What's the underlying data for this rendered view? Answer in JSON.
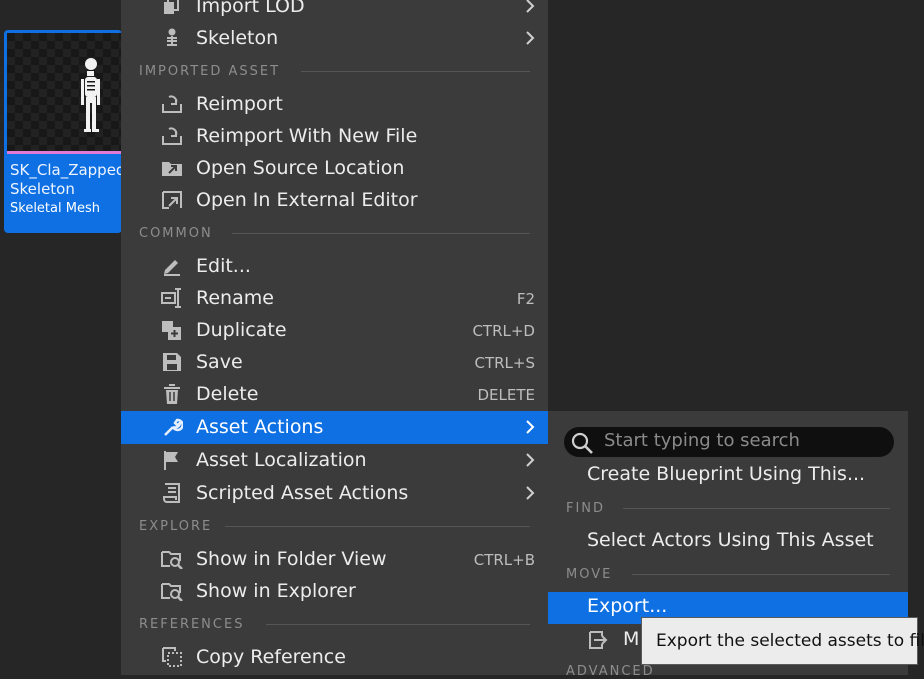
{
  "asset": {
    "name": "SK_Cla_Zapped\nSkeleton",
    "type": "Skeletal Mesh"
  },
  "menu": {
    "items_top": [
      {
        "label": "Import LOD",
        "icon": "import-lod-icon"
      },
      {
        "label": "Skeleton",
        "icon": "skeleton-icon"
      }
    ],
    "imported_asset": {
      "header": "IMPORTED ASSET",
      "items": [
        {
          "label": "Reimport",
          "icon": "reimport-icon"
        },
        {
          "label": "Reimport With New File",
          "icon": "reimport-new-file-icon"
        },
        {
          "label": "Open Source Location",
          "icon": "open-source-location-icon"
        },
        {
          "label": "Open In External Editor",
          "icon": "external-editor-icon"
        }
      ]
    },
    "common": {
      "header": "COMMON",
      "items": [
        {
          "label": "Edit...",
          "icon": "pencil-icon",
          "shortcut": ""
        },
        {
          "label": "Rename",
          "icon": "rename-icon",
          "shortcut": "F2"
        },
        {
          "label": "Duplicate",
          "icon": "duplicate-icon",
          "shortcut": "CTRL+D"
        },
        {
          "label": "Save",
          "icon": "save-icon",
          "shortcut": "CTRL+S"
        },
        {
          "label": "Delete",
          "icon": "trash-icon",
          "shortcut": "DELETE"
        },
        {
          "label": "Asset Actions",
          "icon": "wrench-icon",
          "shortcut": ""
        },
        {
          "label": "Asset Localization",
          "icon": "flag-icon",
          "shortcut": ""
        },
        {
          "label": "Scripted Asset Actions",
          "icon": "script-icon",
          "shortcut": ""
        }
      ]
    },
    "explore": {
      "header": "EXPLORE",
      "items": [
        {
          "label": "Show in Folder View",
          "icon": "folder-search-icon",
          "shortcut": "CTRL+B"
        },
        {
          "label": "Show in Explorer",
          "icon": "folder-search-icon",
          "shortcut": ""
        }
      ]
    },
    "references": {
      "header": "REFERENCES",
      "items": [
        {
          "label": "Copy Reference",
          "icon": "copy-reference-icon"
        }
      ]
    }
  },
  "submenu": {
    "search_placeholder": "Start typing to search",
    "create_blueprint": "Create Blueprint Using This...",
    "find_header": "FIND",
    "select_actors": "Select Actors Using This Asset",
    "move_header": "MOVE",
    "export": "Export...",
    "migrate_partial": "M",
    "advanced_header": "ADVANCED"
  },
  "tooltip": "Export the selected assets to file.",
  "colors": {
    "selection": "#0e70e3",
    "menu_bg": "#3b3b3b",
    "asset_accent": "#e07ad6"
  }
}
